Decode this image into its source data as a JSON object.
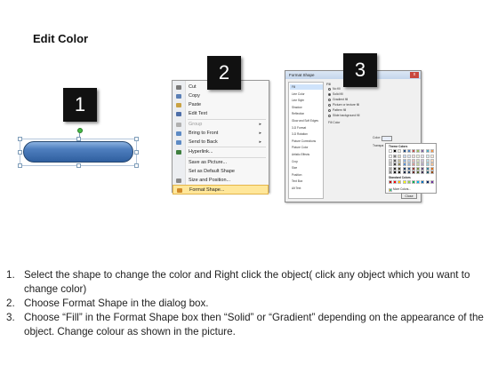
{
  "title": "Edit Color",
  "badges": [
    "1",
    "2",
    "3"
  ],
  "context_menu": {
    "items": [
      {
        "label": "Cut",
        "state": "normal",
        "icon": "scissors-icon",
        "color": "#7a7a7a"
      },
      {
        "label": "Copy",
        "state": "normal",
        "icon": "copy-icon",
        "color": "#5a7fb5"
      },
      {
        "label": "Paste",
        "state": "normal",
        "icon": "paste-icon",
        "color": "#c9a243"
      },
      {
        "label": "Edit Text",
        "state": "normal",
        "icon": "edit-text-icon",
        "color": "#4d6ea8"
      },
      {
        "label": "Group",
        "state": "disabled",
        "icon": "group-icon",
        "color": "#b0b0b0",
        "submenu": true
      },
      {
        "label": "Bring to Front",
        "state": "normal",
        "icon": "bring-to-front-icon",
        "color": "#5d8ac4",
        "submenu": true
      },
      {
        "label": "Send to Back",
        "state": "normal",
        "icon": "send-to-back-icon",
        "color": "#5d8ac4",
        "submenu": true
      },
      {
        "label": "Hyperlink...",
        "state": "normal",
        "icon": "hyperlink-icon",
        "color": "#3f7f3f"
      },
      {
        "label": "Save as Picture...",
        "state": "normal"
      },
      {
        "label": "Set as Default Shape",
        "state": "normal"
      },
      {
        "label": "Size and Position...",
        "state": "normal",
        "icon": "size-icon",
        "color": "#8a8a8a"
      },
      {
        "label": "Format Shape...",
        "state": "highlighted",
        "icon": "format-shape-icon",
        "color": "#d28a2a"
      }
    ]
  },
  "dialog": {
    "title": "Format Shape",
    "close_glyph": "x",
    "nav_items": [
      "Fill",
      "Line Color",
      "Line Style",
      "Shadow",
      "Reflection",
      "Glow and Soft Edges",
      "3-D Format",
      "3-D Rotation",
      "Picture Corrections",
      "Picture Color",
      "Artistic Effects",
      "Crop",
      "Size",
      "Position",
      "Text Box",
      "Alt Text"
    ],
    "pane_heading": "Fill",
    "fill_options": [
      "No fill",
      "Solid fill",
      "Gradient fill",
      "Picture or texture fill",
      "Pattern fill",
      "Slide background fill"
    ],
    "selected_option": "Solid fill",
    "fill_color_label": "Fill Color",
    "color_label": "Color:",
    "transparency_label": "Transpa",
    "palette": {
      "theme_heading": "Theme Colors",
      "standard_heading": "Standard Colors",
      "more_colors": "More Colors...",
      "theme_top": [
        "#ffffff",
        "#000000",
        "#eeece1",
        "#1f497d",
        "#4f81bd",
        "#c0504d",
        "#9bbb59",
        "#8064a2",
        "#4bacc6",
        "#f79646"
      ],
      "theme_tints": [
        [
          "#f2f2f2",
          "#7f7f7f",
          "#ddd9c3",
          "#c6d9f0",
          "#dbe5f1",
          "#f2dcdb",
          "#ebf1dd",
          "#e5e0ec",
          "#dbeef3",
          "#fdeada"
        ],
        [
          "#d8d8d8",
          "#595959",
          "#c4bd97",
          "#8db3e2",
          "#b8cce4",
          "#e5b9b7",
          "#d7e3bc",
          "#ccc1d9",
          "#b7dde8",
          "#fbd5b5"
        ],
        [
          "#bfbfbf",
          "#3f3f3f",
          "#938953",
          "#548dd4",
          "#95b3d7",
          "#d99694",
          "#c3d69b",
          "#b2a2c7",
          "#92cddc",
          "#fac08f"
        ],
        [
          "#a5a5a5",
          "#262626",
          "#494429",
          "#17365d",
          "#366092",
          "#953734",
          "#76923c",
          "#5f497a",
          "#31859b",
          "#e36c09"
        ],
        [
          "#7f7f7f",
          "#0c0c0c",
          "#1d1b10",
          "#0f243e",
          "#244061",
          "#632423",
          "#4f6128",
          "#3f3151",
          "#205867",
          "#974806"
        ]
      ],
      "standard": [
        "#c00000",
        "#ff0000",
        "#ffc000",
        "#ffff00",
        "#92d050",
        "#00b050",
        "#00b0f0",
        "#0070c0",
        "#002060",
        "#7030a0"
      ]
    },
    "close_button": "Close"
  },
  "shape": {
    "fill": "#4f7fbf",
    "outline": "#24466f"
  },
  "instructions": [
    {
      "num": "1.",
      "text": "Select the shape to change the color and Right click the object( click any object which you want to change color)"
    },
    {
      "num": "2.",
      "text": "Choose Format Shape in the dialog box."
    },
    {
      "num": "3.",
      "text": "Choose “Fill” in the Format Shape box then “Solid” or “Gradient” depending on the appearance of the object. Change colour as shown in the picture."
    }
  ]
}
